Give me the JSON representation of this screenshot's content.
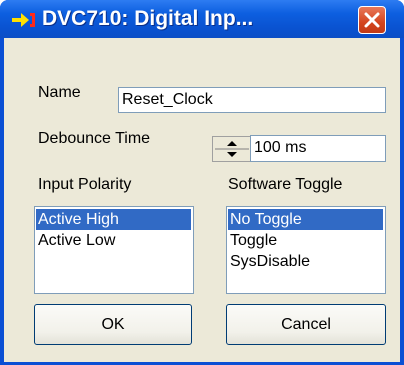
{
  "window": {
    "title": "DVC710: Digital Inp..."
  },
  "icons": {
    "title_icon": "arrow-into-bracket-icon",
    "close_icon": "close-x-icon",
    "spin_up_icon": "triangle-up-icon",
    "spin_down_icon": "triangle-down-icon"
  },
  "fields": {
    "name_label": "Name",
    "name_value": "Reset_Clock",
    "debounce_label": "Debounce Time",
    "debounce_value": "100 ms"
  },
  "input_polarity": {
    "label": "Input Polarity",
    "items": [
      "Active High",
      "Active Low"
    ],
    "selected": "Active High"
  },
  "software_toggle": {
    "label": "Software Toggle",
    "items": [
      "No Toggle",
      "Toggle",
      "SysDisable"
    ],
    "selected": "No Toggle"
  },
  "buttons": {
    "ok": "OK",
    "cancel": "Cancel"
  },
  "colors": {
    "titlebar_blue": "#0a52d0",
    "dialog_face": "#ece9d8",
    "selection": "#316ac5",
    "close_red": "#d4451f",
    "title_icon_yellow": "#ffe000"
  }
}
